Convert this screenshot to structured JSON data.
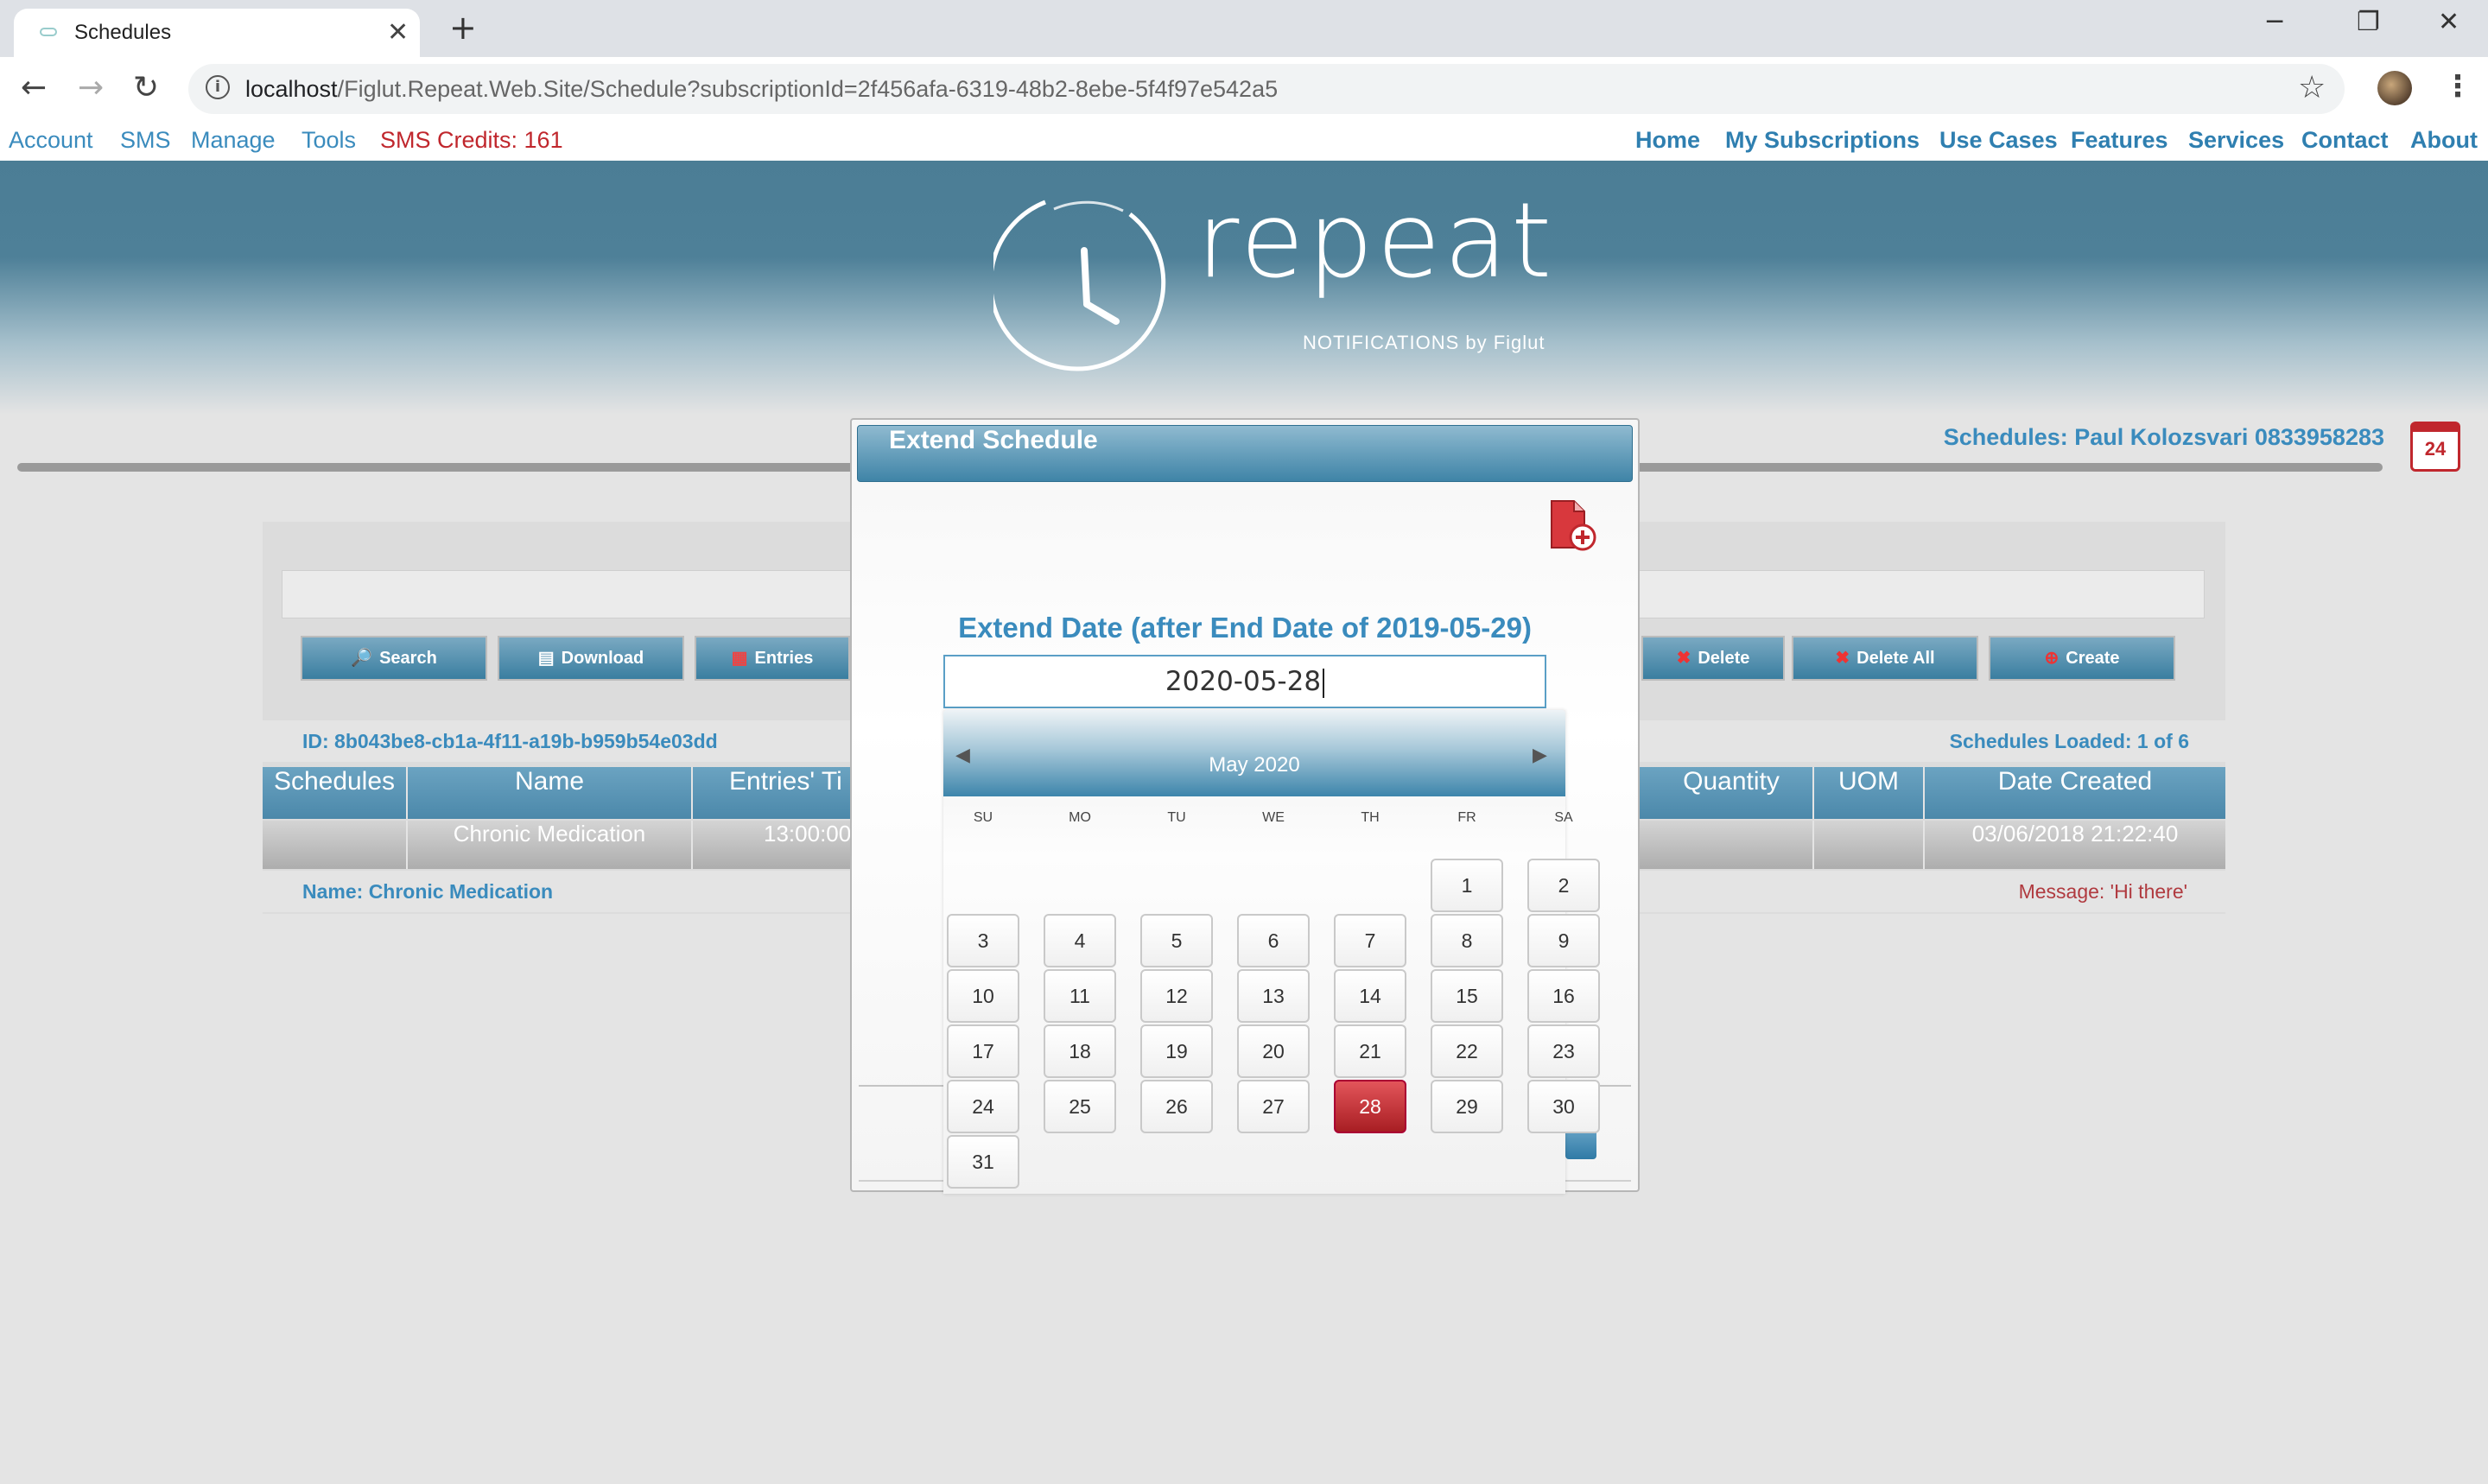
{
  "browser": {
    "tab_title": "Schedules",
    "url_host": "localhost",
    "url_path": "/Figlut.Repeat.Web.Site/Schedule?subscriptionId=2f456afa-6319-48b2-8ebe-5f4f97e542a5"
  },
  "site_nav": {
    "left": [
      "Account",
      "SMS",
      "Manage",
      "Tools"
    ],
    "credits": "SMS Credits: 161",
    "right": [
      "Home",
      "My Subscriptions",
      "Use Cases",
      "Features",
      "Services",
      "Contact",
      "About"
    ]
  },
  "logo": {
    "word": "repeat",
    "sub": "NOTIFICATIONS by Figlut"
  },
  "schedules_title": "Schedules: Paul Kolozsvari 0833958283",
  "calendar_badge": "24",
  "toolbar_buttons": {
    "search": "Search",
    "download": "Download",
    "entries": "Entries",
    "delete": "Delete",
    "delete_all": "Delete All",
    "create": "Create"
  },
  "info": {
    "id": "ID: 8b043be8-cb1a-4f11-a19b-b959b54e03dd",
    "loaded": "Schedules Loaded: 1 of 6"
  },
  "table": {
    "headers": {
      "schedules": "Schedules",
      "name": "Name",
      "entries_time": "Entries' Ti",
      "quantity": "Quantity",
      "uom": "UOM",
      "date_created": "Date Created"
    },
    "row": {
      "name": "Chronic Medication",
      "entries_time": "13:00:00",
      "date_created": "03/06/2018 21:22:40"
    }
  },
  "footer": {
    "name": "Name: Chronic Medication",
    "message": "Message: 'Hi there'"
  },
  "dialog": {
    "title": "Extend Schedule",
    "label": "Extend Date (after End Date of 2019-05-29)",
    "value": "2020-05-28"
  },
  "calendar": {
    "month": "May 2020",
    "weekdays": [
      "SU",
      "MO",
      "TU",
      "WE",
      "TH",
      "FR",
      "SA"
    ],
    "first_weekday_index": 5,
    "days_in_month": 31,
    "selected_day": 28,
    "prev_arrow": "◀",
    "next_arrow": "▶"
  },
  "colors": {
    "accent_blue": "#3a8bbd",
    "credits_red": "#c0272d",
    "selected_day": "#c0272d"
  }
}
